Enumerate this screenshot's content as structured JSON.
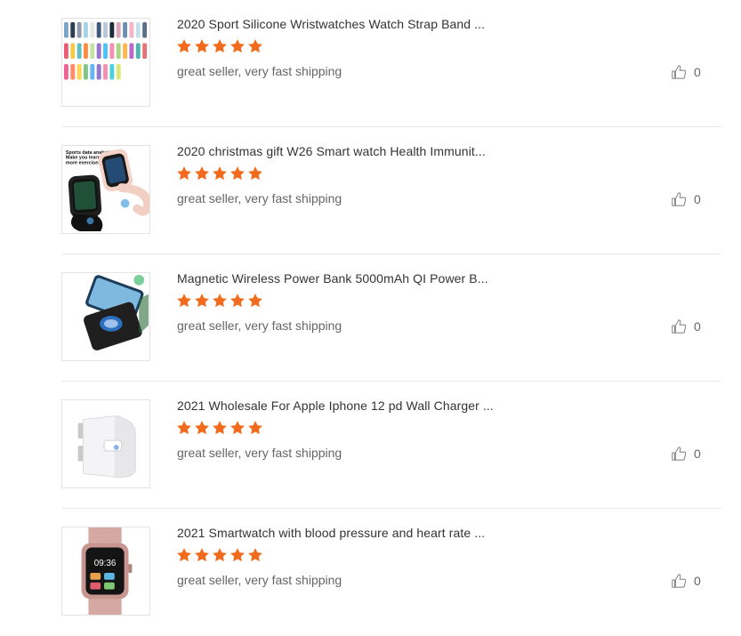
{
  "reviews": [
    {
      "image_icon": "silicone-strap-bands-icon",
      "title": "2020 Sport Silicone Wristwatches Watch Strap Band ...",
      "rating": 5,
      "comment": "great seller, very fast shipping",
      "likes": "0"
    },
    {
      "image_icon": "smart-watch-product-icon",
      "title": "2020 christmas gift W26 Smart watch Health Immunit...",
      "rating": 5,
      "comment": "great seller, very fast shipping",
      "likes": "0"
    },
    {
      "image_icon": "power-bank-product-icon",
      "title": "Magnetic Wireless Power Bank 5000mAh QI Power B...",
      "rating": 5,
      "comment": "great seller, very fast shipping",
      "likes": "0"
    },
    {
      "image_icon": "wall-charger-product-icon",
      "title": "2021 Wholesale For Apple Iphone 12 pd Wall Charger ...",
      "rating": 5,
      "comment": "great seller, very fast shipping",
      "likes": "0"
    },
    {
      "image_icon": "pink-smartwatch-product-icon",
      "title": "2021 Smartwatch with blood pressure and heart rate ...",
      "rating": 5,
      "comment": "great seller, very fast shipping",
      "likes": "0"
    }
  ],
  "colors": {
    "star": "#f26b1d",
    "text": "#333333",
    "muted": "#666666",
    "divider": "#e8e8e8"
  },
  "thumbnail_texts": {
    "watch_promo": "Sports data analysis Make you learn more exercises",
    "watch_time": "09:36"
  }
}
